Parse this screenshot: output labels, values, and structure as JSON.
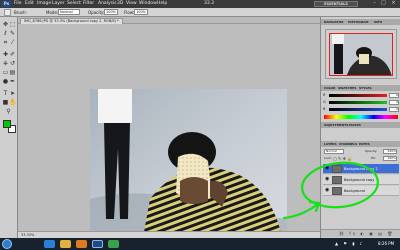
{
  "app": {
    "logo": "Ps",
    "menu": [
      "File",
      "Edit",
      "Image",
      "Layer",
      "Select",
      "Filter",
      "Analysis",
      "3D",
      "View",
      "Window",
      "Help"
    ],
    "zoom_select": "33.3",
    "workspace": "ESSENTIALS"
  },
  "options_bar": {
    "brush_label": "Brush:",
    "mode_label": "Mode:",
    "mode_value": "Normal",
    "opacity_label": "Opacity:",
    "opacity_value": "100%",
    "flow_label": "Flow:",
    "flow_value": "100%"
  },
  "toolbox": {
    "tools": [
      "move-tool",
      "marquee-tool",
      "lasso-tool",
      "quick-select-tool",
      "crop-tool",
      "eyedropper-tool",
      "healing-tool",
      "brush-tool",
      "clone-tool",
      "history-brush-tool",
      "eraser-tool",
      "gradient-tool",
      "dodge-tool",
      "pen-tool",
      "type-tool",
      "path-select-tool",
      "shape-tool",
      "hand-tool",
      "zoom-tool"
    ],
    "foreground_color": "#00c800",
    "background_color": "#ffffff"
  },
  "document": {
    "tab_label": "IMG_8786.JPG @ 33.3% (Background copy 2, RGB/8) *",
    "status": "33.33%"
  },
  "panels": {
    "navigator_tabs": [
      "NAVIGATOR",
      "HISTOGRAM",
      "INFO"
    ],
    "color_tabs": [
      "COLOR",
      "SWATCHES",
      "STYLES"
    ],
    "color_sliders": [
      {
        "label": "R",
        "value": "0",
        "color": "#e02020"
      },
      {
        "label": "G",
        "value": "0",
        "color": "#20c020"
      },
      {
        "label": "B",
        "value": "0",
        "color": "#2050e0"
      }
    ],
    "adjust_tabs": [
      "ADJUSTMENTS",
      "MASKS"
    ],
    "layers_tabs": [
      "LAYERS",
      "CHANNELS",
      "PATHS"
    ],
    "blend_mode": "Normal",
    "opacity_label": "Opacity:",
    "opacity_value": "100%",
    "lock_label": "Lock:",
    "fill_label": "Fill:",
    "fill_value": "100%",
    "layers": [
      {
        "name": "Background copy 2",
        "active": true
      },
      {
        "name": "Background copy",
        "active": false
      },
      {
        "name": "Background",
        "active": false
      }
    ],
    "annotation_color": "#18e018"
  },
  "taskbar": {
    "app_icons": [
      "ie-icon",
      "folder-icon",
      "media-player-icon",
      "photoshop-icon",
      "chat-icon"
    ],
    "time": "8:26 PM"
  }
}
